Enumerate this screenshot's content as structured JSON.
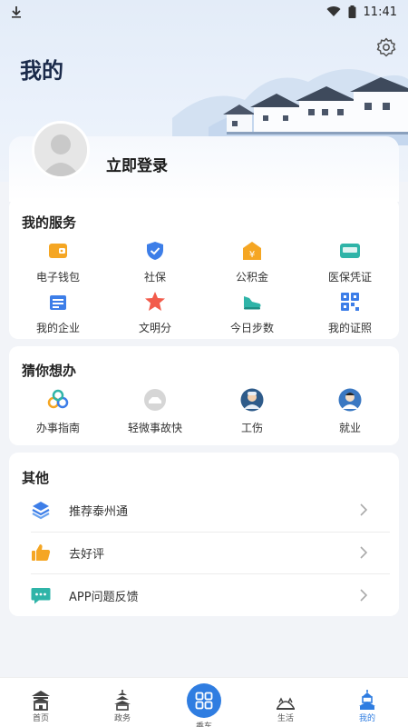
{
  "status": {
    "time": "11:41"
  },
  "header": {
    "title": "我的"
  },
  "login": {
    "label": "立即登录"
  },
  "my_services": {
    "title": "我的服务",
    "items": [
      {
        "label": "电子钱包",
        "icon": "wallet-icon",
        "color": "#f5a623"
      },
      {
        "label": "社保",
        "icon": "shield-check-icon",
        "color": "#3d7ee8"
      },
      {
        "label": "公积金",
        "icon": "house-fund-icon",
        "color": "#f5a623"
      },
      {
        "label": "医保凭证",
        "icon": "medical-card-icon",
        "color": "#2fb4a8"
      },
      {
        "label": "我的企业",
        "icon": "enterprise-icon",
        "color": "#3d7ee8"
      },
      {
        "label": "文明分",
        "icon": "star-badge-icon",
        "color": "#f25b4b"
      },
      {
        "label": "今日步数",
        "icon": "shoe-icon",
        "color": "#2fb4a8"
      },
      {
        "label": "我的证照",
        "icon": "qr-code-icon",
        "color": "#3d7ee8"
      }
    ]
  },
  "guess": {
    "title": "猜你想办",
    "items": [
      {
        "label": "办事指南",
        "icon": "guide-icon"
      },
      {
        "label": "轻微事故快",
        "icon": "accident-icon"
      },
      {
        "label": "工伤",
        "icon": "injury-icon"
      },
      {
        "label": "就业",
        "icon": "employment-icon"
      }
    ]
  },
  "other": {
    "title": "其他",
    "items": [
      {
        "label": "推荐泰州通",
        "icon": "recommend-icon"
      },
      {
        "label": "去好评",
        "icon": "thumbs-up-icon"
      },
      {
        "label": "APP问题反馈",
        "icon": "feedback-icon"
      }
    ]
  },
  "tabbar": {
    "tabs": [
      {
        "label": "首页",
        "icon": "home-building-icon"
      },
      {
        "label": "政务",
        "icon": "pagoda-icon"
      },
      {
        "label": "乘车",
        "icon": "scan-ride-icon"
      },
      {
        "label": "生活",
        "icon": "life-icon"
      },
      {
        "label": "我的",
        "icon": "profile-building-icon"
      }
    ],
    "active": "我的",
    "accent": "#2f7de1"
  }
}
